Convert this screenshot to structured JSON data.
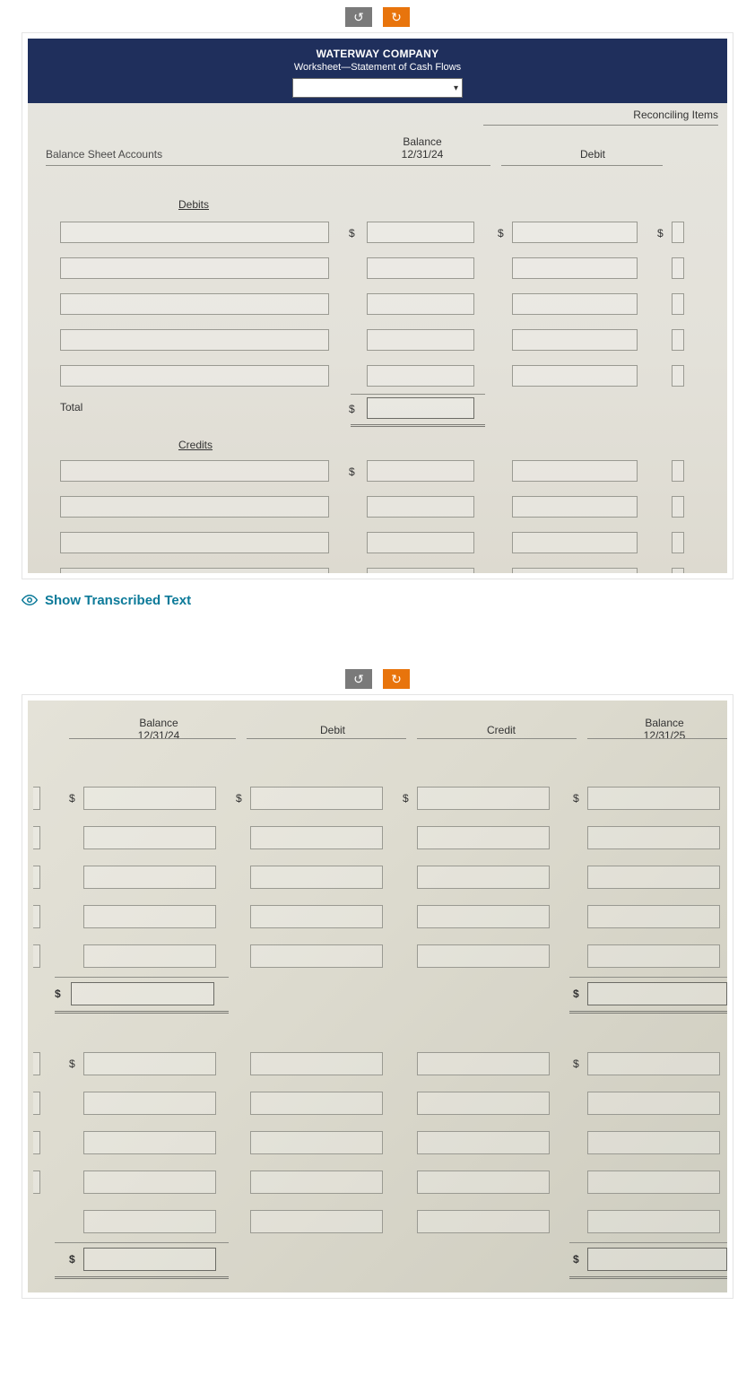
{
  "buttons": {
    "rotate_left": "↺",
    "rotate_right": "↻"
  },
  "image1": {
    "company": "WATERWAY COMPANY",
    "subtitle": "Worksheet—Statement of Cash Flows",
    "reconciling": "Reconciling Items",
    "col_accounts": "Balance Sheet Accounts",
    "col_balance_line1": "Balance",
    "col_balance_line2": "12/31/24",
    "col_debit": "Debit",
    "section_debits": "Debits",
    "section_credits": "Credits",
    "total_label": "Total",
    "dollar": "$"
  },
  "show_transcribed": "Show Transcribed Text",
  "image2": {
    "col_balance24_l1": "Balance",
    "col_balance24_l2": "12/31/24",
    "col_debit": "Debit",
    "col_credit": "Credit",
    "col_balance25_l1": "Balance",
    "col_balance25_l2": "12/31/25",
    "dollar": "$"
  }
}
